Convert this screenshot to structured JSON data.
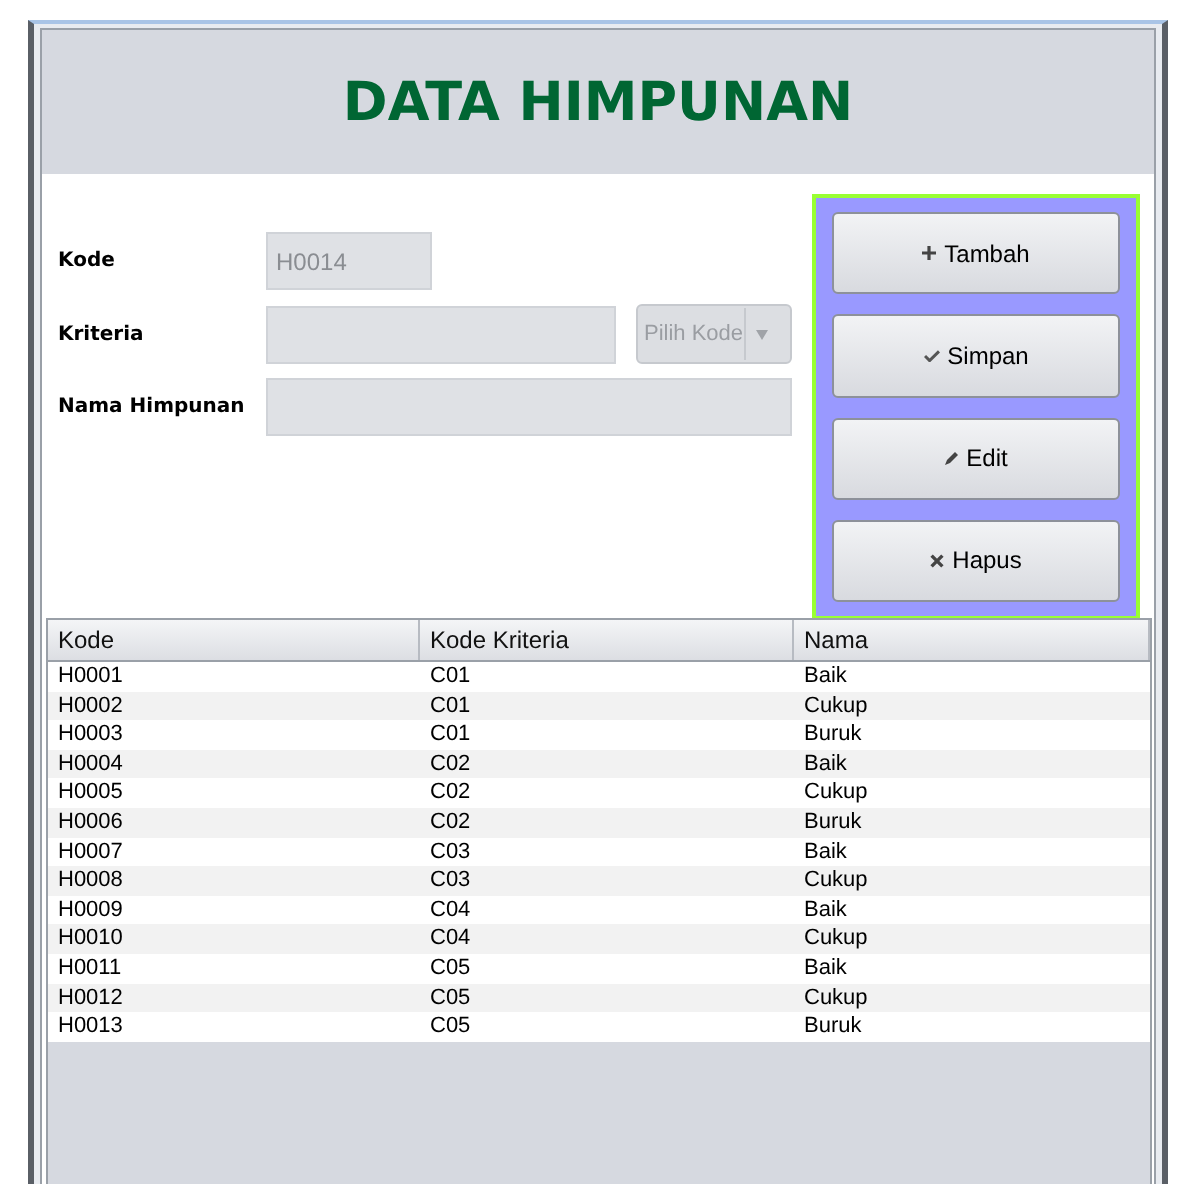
{
  "title": "DATA HIMPUNAN",
  "form": {
    "fields": [
      {
        "label": "Kode",
        "kind": "text",
        "value": "H0014"
      },
      {
        "label": "Kriteria",
        "kind": "text-combo",
        "combo": "Pilih Kode"
      },
      {
        "label": "Nama Himpunan",
        "kind": "wide"
      }
    ]
  },
  "buttons": [
    {
      "label": "Tambah",
      "kind": "plus"
    },
    {
      "label": "Simpan",
      "kind": "check"
    },
    {
      "label": "Edit",
      "kind": "pencil"
    },
    {
      "label": "Hapus",
      "kind": "cross"
    }
  ],
  "table": {
    "columns": [
      "Kode",
      "Kode Kriteria",
      "Nama"
    ],
    "rows": [
      [
        "H0001",
        "C01",
        "Baik"
      ],
      [
        "H0002",
        "C01",
        "Cukup"
      ],
      [
        "H0003",
        "C01",
        "Buruk"
      ],
      [
        "H0004",
        "C02",
        "Baik"
      ],
      [
        "H0005",
        "C02",
        "Cukup"
      ],
      [
        "H0006",
        "C02",
        "Buruk"
      ],
      [
        "H0007",
        "C03",
        "Baik"
      ],
      [
        "H0008",
        "C03",
        "Cukup"
      ],
      [
        "H0009",
        "C04",
        "Baik"
      ],
      [
        "H0010",
        "C04",
        "Cukup"
      ],
      [
        "H0011",
        "C05",
        "Baik"
      ],
      [
        "H0012",
        "C05",
        "Cukup"
      ],
      [
        "H0013",
        "C05",
        "Buruk"
      ]
    ]
  }
}
